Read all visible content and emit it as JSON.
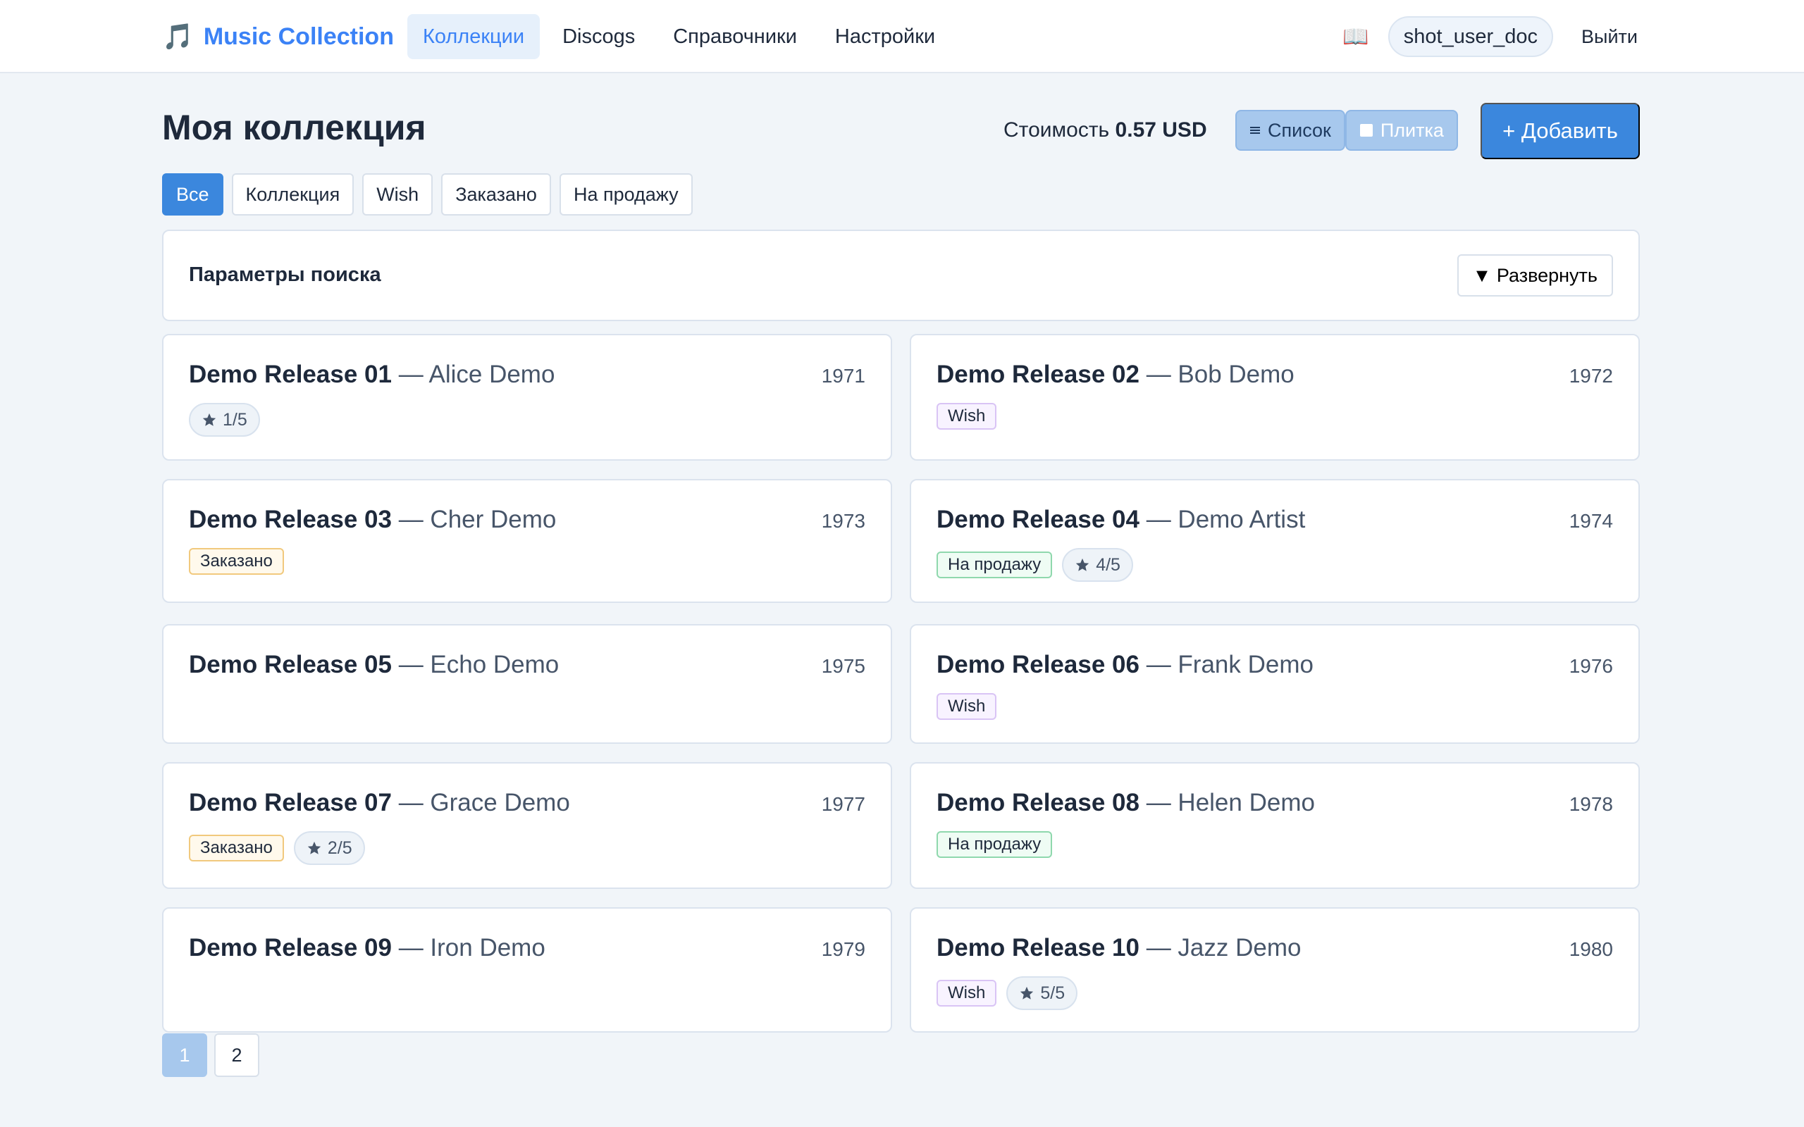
{
  "header": {
    "brand_icon": "🎵",
    "brand": "Music Collection",
    "nav": [
      {
        "label": "Коллекции",
        "active": true
      },
      {
        "label": "Discogs"
      },
      {
        "label": "Справочники"
      },
      {
        "label": "Настройки"
      }
    ],
    "docs_icon": "📖",
    "user": "shot_user_doc",
    "logout": "Выйти"
  },
  "page": {
    "title": "Моя коллекция",
    "cost_label": "Стоимость",
    "cost_value": "0.57 USD",
    "view_list": "Список",
    "view_tile": "Плитка",
    "add": "+ Добавить"
  },
  "filters": [
    "Все",
    "Коллекция",
    "Wish",
    "Заказано",
    "На продажу"
  ],
  "search": {
    "title": "Параметры поиска",
    "expand": "▼ Развернуть"
  },
  "releases": [
    {
      "title": "Demo Release 01",
      "artist": "— Alice Demo",
      "year": "1971",
      "status": "",
      "rating": "1/5"
    },
    {
      "title": "Demo Release 02",
      "artist": "— Bob Demo",
      "year": "1972",
      "status": "Wish",
      "rating": ""
    },
    {
      "title": "Demo Release 03",
      "artist": "— Cher Demo",
      "year": "1973",
      "status": "Заказано",
      "rating": ""
    },
    {
      "title": "Demo Release 04",
      "artist": "— Demo Artist",
      "year": "1974",
      "status": "На продажу",
      "rating": "4/5"
    },
    {
      "title": "Demo Release 05",
      "artist": "— Echo Demo",
      "year": "1975",
      "status": "",
      "rating": ""
    },
    {
      "title": "Demo Release 06",
      "artist": "— Frank Demo",
      "year": "1976",
      "status": "Wish",
      "rating": ""
    },
    {
      "title": "Demo Release 07",
      "artist": "— Grace Demo",
      "year": "1977",
      "status": "Заказано",
      "rating": "2/5"
    },
    {
      "title": "Demo Release 08",
      "artist": "— Helen Demo",
      "year": "1978",
      "status": "На продажу",
      "rating": ""
    },
    {
      "title": "Demo Release 09",
      "artist": "— Iron Demo",
      "year": "1979",
      "status": "",
      "rating": ""
    },
    {
      "title": "Demo Release 10",
      "artist": "— Jazz Demo",
      "year": "1980",
      "status": "Wish",
      "rating": "5/5"
    }
  ],
  "pagination": {
    "pages": [
      "1",
      "2"
    ],
    "current": "1"
  },
  "icons": {
    "star": "star-icon",
    "list": "list-icon",
    "tile": "tile-icon"
  },
  "colors": {
    "accent": "#3b87dd",
    "brand": "#3b82f6"
  }
}
